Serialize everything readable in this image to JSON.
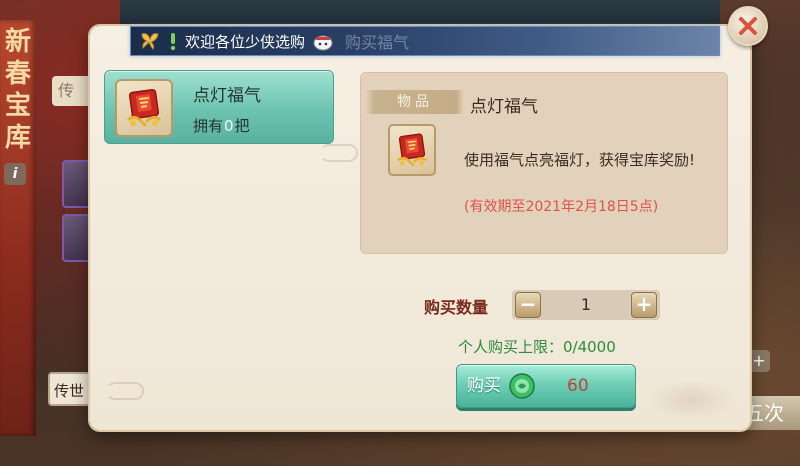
{
  "background": {
    "side_title": "新春宝库",
    "info_label": "i",
    "left_tab_text": "传",
    "left_button_text": "传世",
    "right_button_text": "五次",
    "plus_label": "+"
  },
  "marquee": {
    "text": "欢迎各位少侠选购",
    "ghost_text": "购买福气"
  },
  "list": {
    "items": [
      {
        "name": "点灯福气",
        "owned_prefix": "拥有",
        "owned_count": "0",
        "owned_suffix": "把"
      }
    ]
  },
  "detail": {
    "tag": "物品",
    "name": "点灯福气",
    "description": "使用福气点亮福灯，获得宝库奖励!",
    "validity": "(有效期至2021年2月18日5点)"
  },
  "purchase": {
    "quantity_label": "购买数量",
    "quantity_value": "1",
    "minus_label": "−",
    "plus_label": "+",
    "limit_text": "个人购买上限：0/4000",
    "buy_label": "购买",
    "price": "60"
  },
  "colors": {
    "accent_teal": "#6cc4b0",
    "price_red": "#c0413a",
    "validity_red": "#e0524a",
    "limit_green": "#2f8a3f"
  },
  "icons": {
    "close": "close-icon",
    "currency": "jade-icon",
    "item": "red-lantern-book-icon"
  }
}
